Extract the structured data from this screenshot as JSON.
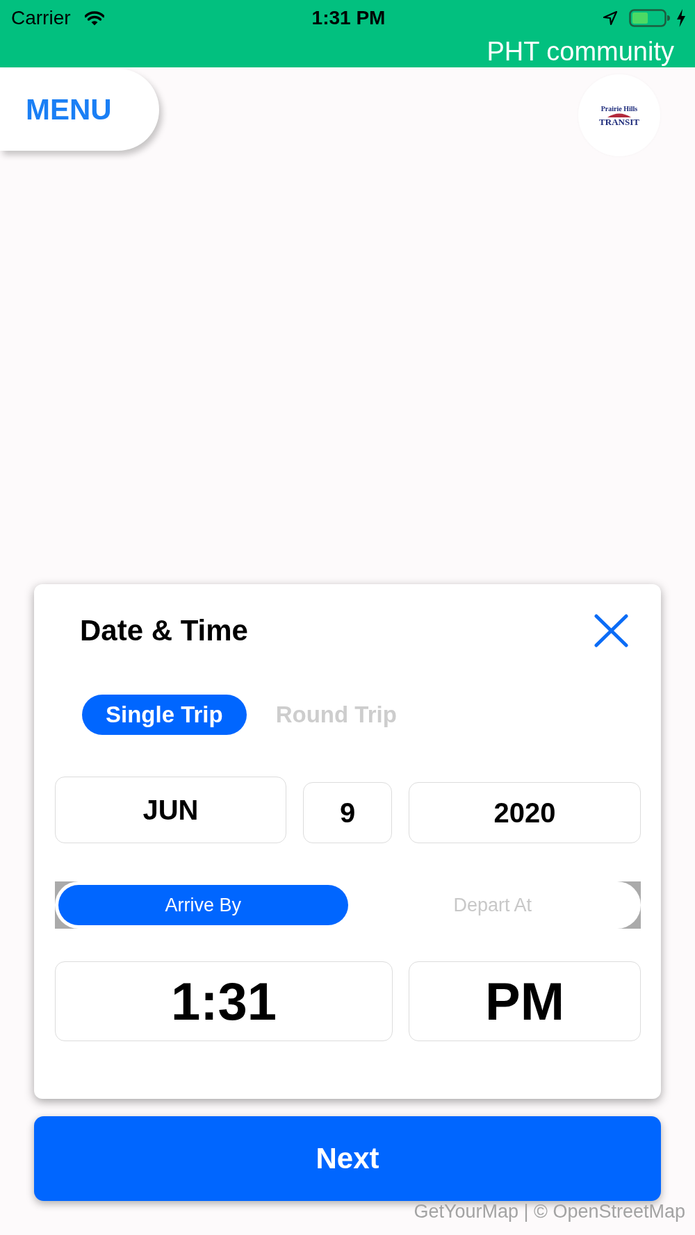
{
  "status_bar": {
    "carrier": "Carrier",
    "time": "1:31 PM"
  },
  "header": {
    "title": "PHT community"
  },
  "menu_button": {
    "label": "MENU"
  },
  "logo": {
    "top_text": "Prairie Hills",
    "bottom_text": "TRANSIT"
  },
  "dialog": {
    "title": "Date & Time",
    "trip_tabs": [
      {
        "label": "Single Trip",
        "selected": true
      },
      {
        "label": "Round Trip",
        "selected": false
      }
    ],
    "date_fields": [
      "JUN",
      "9",
      "2020"
    ],
    "time_modes": [
      {
        "label": "Arrive By",
        "selected": true
      },
      {
        "label": "Depart At",
        "selected": false
      }
    ],
    "time_fields": [
      "1:31",
      "PM"
    ]
  },
  "next_button": {
    "label": "Next"
  },
  "map_attribution": "GetYourMap | © OpenStreetMap"
}
